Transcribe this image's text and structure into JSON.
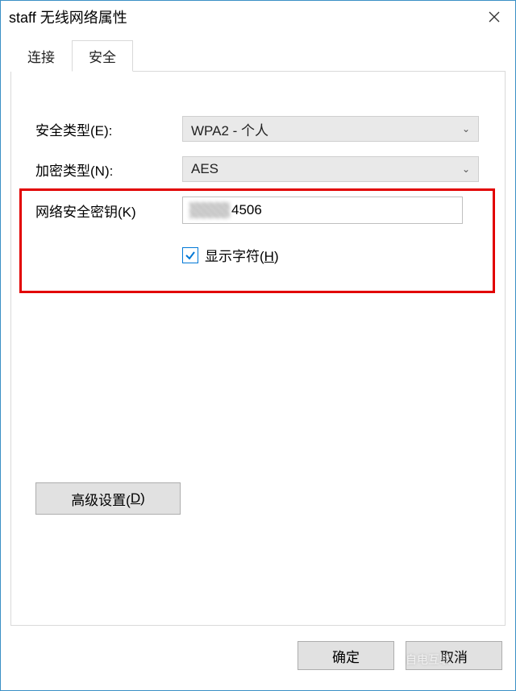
{
  "window": {
    "title": "staff 无线网络属性"
  },
  "tabs": {
    "connection": "连接",
    "security": "安全"
  },
  "form": {
    "security_type_label": "安全类型(E):",
    "security_type_value": "WPA2 - 个人",
    "encryption_type_label": "加密类型(N):",
    "encryption_type_value": "AES",
    "network_key_label": "网络安全密钥(K)",
    "network_key_value": "4506",
    "show_chars_label_pre": "显示字符(",
    "show_chars_hotkey": "H",
    "show_chars_label_post": ")",
    "show_chars_checked": true
  },
  "buttons": {
    "advanced_pre": "高级设置(",
    "advanced_hotkey": "D",
    "advanced_post": ")",
    "ok": "确定",
    "cancel": "取消"
  },
  "watermark": {
    "line1": "自电互联"
  }
}
